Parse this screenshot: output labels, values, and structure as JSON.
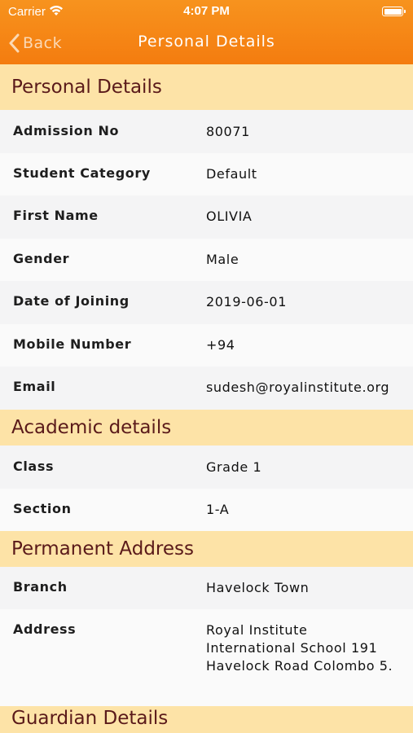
{
  "status_bar": {
    "carrier": "Carrier",
    "time": "4:07 PM"
  },
  "nav": {
    "back_label": "Back",
    "title": "Personal Details"
  },
  "sections": {
    "personal": {
      "title": "Personal Details",
      "rows": [
        {
          "label": "Admission No",
          "value": "80071"
        },
        {
          "label": "Student Category",
          "value": "Default"
        },
        {
          "label": "First Name",
          "value": "OLIVIA"
        },
        {
          "label": "Gender",
          "value": "Male"
        },
        {
          "label": "Date of Joining",
          "value": "2019-06-01"
        },
        {
          "label": "Mobile Number",
          "value": "+94"
        },
        {
          "label": "Email",
          "value": "sudesh@royalinstitute.org"
        }
      ]
    },
    "academic": {
      "title": "Academic details",
      "rows": [
        {
          "label": "Class",
          "value": "Grade 1"
        },
        {
          "label": "Section",
          "value": "1-A"
        }
      ]
    },
    "permanent": {
      "title": "Permanent Address",
      "rows": [
        {
          "label": "Branch",
          "value": "Havelock Town"
        },
        {
          "label": "Address",
          "value": "Royal Institute International School 191 Havelock Road Colombo 5."
        }
      ]
    },
    "guardian": {
      "title": "Guardian Details"
    }
  },
  "colors": {
    "header_orange": "#f47c0f",
    "section_bg": "#fde3a7",
    "section_text": "#5a1a1a"
  }
}
